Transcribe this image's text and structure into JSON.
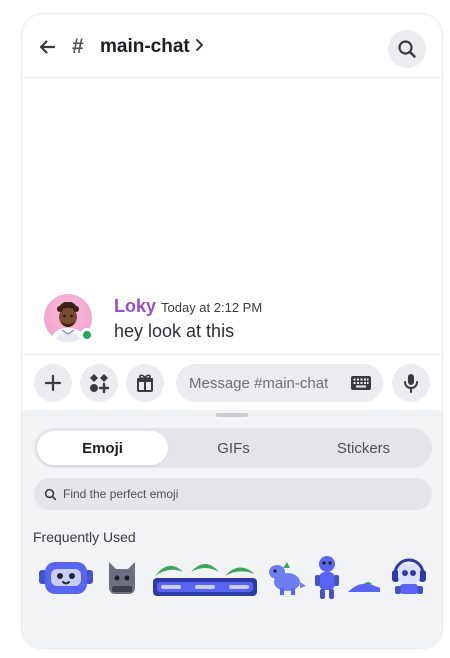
{
  "header": {
    "back_icon": "arrow-left-icon",
    "hash_symbol": "#",
    "channel_name": "main-chat",
    "chevron_icon": "chevron-right-icon",
    "search_icon": "search-icon"
  },
  "message": {
    "username": "Loky",
    "timestamp": "Today at 2:12 PM",
    "text": "hey look at this",
    "username_color": "#9b4fc4",
    "status": "online"
  },
  "composer": {
    "placeholder": "Message #main-chat",
    "buttons": [
      "plus-icon",
      "apps-icon",
      "gift-icon",
      "keyboard-icon",
      "microphone-icon"
    ]
  },
  "emoji_panel": {
    "tabs": [
      {
        "label": "Emoji",
        "active": true
      },
      {
        "label": "GIFs",
        "active": false
      },
      {
        "label": "Stickers",
        "active": false
      }
    ],
    "search_placeholder": "Find the perfect emoji",
    "section_title": "Frequently Used",
    "frequently_used": [
      "blue-robot-emoji",
      "gray-cat-emoji",
      "green-leaves-emoji",
      "blue-dino-emoji",
      "blue-bot-emoji",
      "small-slope-emoji",
      "headphone-robot-emoji"
    ]
  },
  "colors": {
    "online": "#23a55a",
    "panel_bg": "#f2f3f5",
    "input_bg": "#ebecef",
    "accent_blue": "#5865f2"
  }
}
